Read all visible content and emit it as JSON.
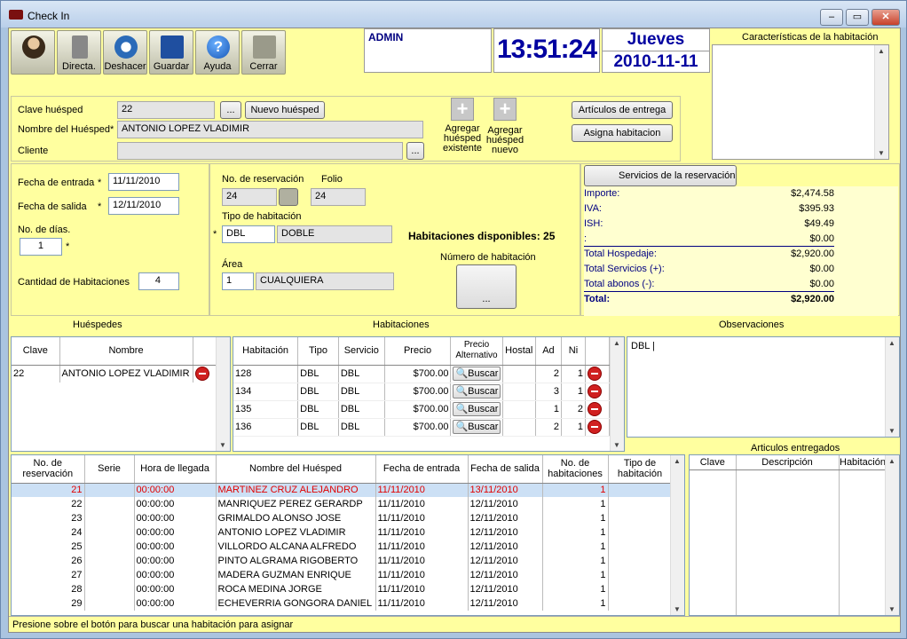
{
  "window": {
    "title": "Check In",
    "min": "–",
    "max": "▭",
    "close": "✕"
  },
  "toolbar": [
    {
      "label": "",
      "icon": "user-icon"
    },
    {
      "label": "Directa.",
      "icon": "document-icon"
    },
    {
      "label": "Deshacer",
      "icon": "undo-icon"
    },
    {
      "label": "Guardar",
      "icon": "save-icon"
    },
    {
      "label": "Ayuda",
      "icon": "help-icon"
    },
    {
      "label": "Cerrar",
      "icon": "exit-icon"
    }
  ],
  "header": {
    "user": "ADMIN",
    "time": "13:51:24",
    "day": "Jueves",
    "date": "2010-11-11",
    "room_features_title": "Características de la habitación"
  },
  "guest": {
    "clave_label": "Clave huésped",
    "clave": "22",
    "ellipsis": "...",
    "nuevo": "Nuevo huésped",
    "nombre_label": "Nombre del Huésped",
    "req": "*",
    "nombre": "ANTONIO LOPEZ VLADIMIR",
    "cliente_label": "Cliente",
    "cliente": "",
    "add_existing": "Agregar huésped existente",
    "add_new": "Agregar huésped nuevo",
    "articulos": "Artículos de entrega",
    "asigna": "Asigna habitacion"
  },
  "stay": {
    "entrada_label": "Fecha de entrada",
    "entrada": "11/11/2010",
    "salida_label": "Fecha de salida",
    "salida": "12/11/2010",
    "dias_label": "No. de días.",
    "dias": "1",
    "cant_label": "Cantidad de Habitaciones",
    "cant": "4"
  },
  "reservation": {
    "no_label": "No. de reservación",
    "no": "24",
    "folio_label": "Folio",
    "folio": "24",
    "tipo_label": "Tipo de habitación",
    "tipo_code": "DBL",
    "tipo_name": "DOBLE",
    "area_label": "Área",
    "area_code": "1",
    "area_name": "CUALQUIERA",
    "disponibles": "Habitaciones disponibles: 25",
    "numero_label": "Número de habitación",
    "numero_btn": "..."
  },
  "services": {
    "btn": "Servicios de la reservación",
    "rows": [
      {
        "label": "Importe:",
        "value": "$2,474.58"
      },
      {
        "label": "IVA:",
        "value": "$395.93"
      },
      {
        "label": "ISH:",
        "value": "$49.49"
      },
      {
        "label": ":",
        "value": "$0.00"
      },
      {
        "label": "Total Hospedaje:",
        "value": "$2,920.00"
      },
      {
        "label": "Total Servicios (+):",
        "value": "$0.00"
      },
      {
        "label": "Total abonos (-):",
        "value": "$0.00"
      },
      {
        "label": "Total:",
        "value": "$2,920.00"
      }
    ]
  },
  "sections": {
    "huespedes": "Huéspedes",
    "habitaciones": "Habitaciones",
    "observaciones": "Observaciones",
    "articulos_entregados": "Articulos entregados"
  },
  "guests_grid": {
    "columns": [
      "Clave",
      "Nombre"
    ],
    "rows": [
      {
        "clave": "22",
        "nombre": "ANTONIO LOPEZ VLADIMIR"
      }
    ]
  },
  "rooms_grid": {
    "columns": [
      "Habitación",
      "Tipo",
      "Servicio",
      "Precio",
      "Precio Alternativo",
      "Hostal",
      "Ad",
      "Ni"
    ],
    "buscar": "Buscar",
    "rows": [
      {
        "hab": "128",
        "tipo": "DBL",
        "serv": "DBL",
        "precio": "$700.00",
        "ad": "2",
        "ni": "1"
      },
      {
        "hab": "134",
        "tipo": "DBL",
        "serv": "DBL",
        "precio": "$700.00",
        "ad": "3",
        "ni": "1"
      },
      {
        "hab": "135",
        "tipo": "DBL",
        "serv": "DBL",
        "precio": "$700.00",
        "ad": "1",
        "ni": "2"
      },
      {
        "hab": "136",
        "tipo": "DBL",
        "serv": "DBL",
        "precio": "$700.00",
        "ad": "2",
        "ni": "1"
      }
    ]
  },
  "observaciones": "DBL |",
  "reservations_grid": {
    "columns": [
      "No. de reservación",
      "Serie",
      "Hora de llegada",
      "Nombre del Huésped",
      "Fecha de entrada",
      "Fecha de salida",
      "No. de habitaciones",
      "Tipo de habitación"
    ],
    "rows": [
      {
        "no": "21",
        "serie": "",
        "hora": "00:00:00",
        "nombre": "MARTINEZ CRUZ ALEJANDRO",
        "entrada": "11/11/2010",
        "salida": "13/11/2010",
        "hab": "1",
        "tipo": ""
      },
      {
        "no": "22",
        "serie": "",
        "hora": "00:00:00",
        "nombre": "MANRIQUEZ PEREZ GERARDP",
        "entrada": "11/11/2010",
        "salida": "12/11/2010",
        "hab": "1",
        "tipo": ""
      },
      {
        "no": "23",
        "serie": "",
        "hora": "00:00:00",
        "nombre": "GRIMALDO ALONSO JOSE",
        "entrada": "11/11/2010",
        "salida": "12/11/2010",
        "hab": "1",
        "tipo": ""
      },
      {
        "no": "24",
        "serie": "",
        "hora": "00:00:00",
        "nombre": "ANTONIO LOPEZ VLADIMIR",
        "entrada": "11/11/2010",
        "salida": "12/11/2010",
        "hab": "1",
        "tipo": ""
      },
      {
        "no": "25",
        "serie": "",
        "hora": "00:00:00",
        "nombre": "VILLORDO ALCANA ALFREDO",
        "entrada": "11/11/2010",
        "salida": "12/11/2010",
        "hab": "1",
        "tipo": ""
      },
      {
        "no": "26",
        "serie": "",
        "hora": "00:00:00",
        "nombre": "PINTO ALGRAMA RIGOBERTO",
        "entrada": "11/11/2010",
        "salida": "12/11/2010",
        "hab": "1",
        "tipo": ""
      },
      {
        "no": "27",
        "serie": "",
        "hora": "00:00:00",
        "nombre": "MADERA GUZMAN ENRIQUE",
        "entrada": "11/11/2010",
        "salida": "12/11/2010",
        "hab": "1",
        "tipo": ""
      },
      {
        "no": "28",
        "serie": "",
        "hora": "00:00:00",
        "nombre": "ROCA MEDINA JORGE",
        "entrada": "11/11/2010",
        "salida": "12/11/2010",
        "hab": "1",
        "tipo": ""
      },
      {
        "no": "29",
        "serie": "",
        "hora": "00:00:00",
        "nombre": "ECHEVERRIA GONGORA DANIEL",
        "entrada": "11/11/2010",
        "salida": "12/11/2010",
        "hab": "1",
        "tipo": ""
      }
    ]
  },
  "articles_grid": {
    "columns": [
      "Clave",
      "Descripción",
      "Habitación"
    ]
  },
  "status": "Presione sobre el botón para buscar una habitación para asignar",
  "colors": {
    "panel": "#ffff9f",
    "highlight_text": "#e00000",
    "selected_row": "#cce0f5",
    "accent_blue": "#000080"
  }
}
